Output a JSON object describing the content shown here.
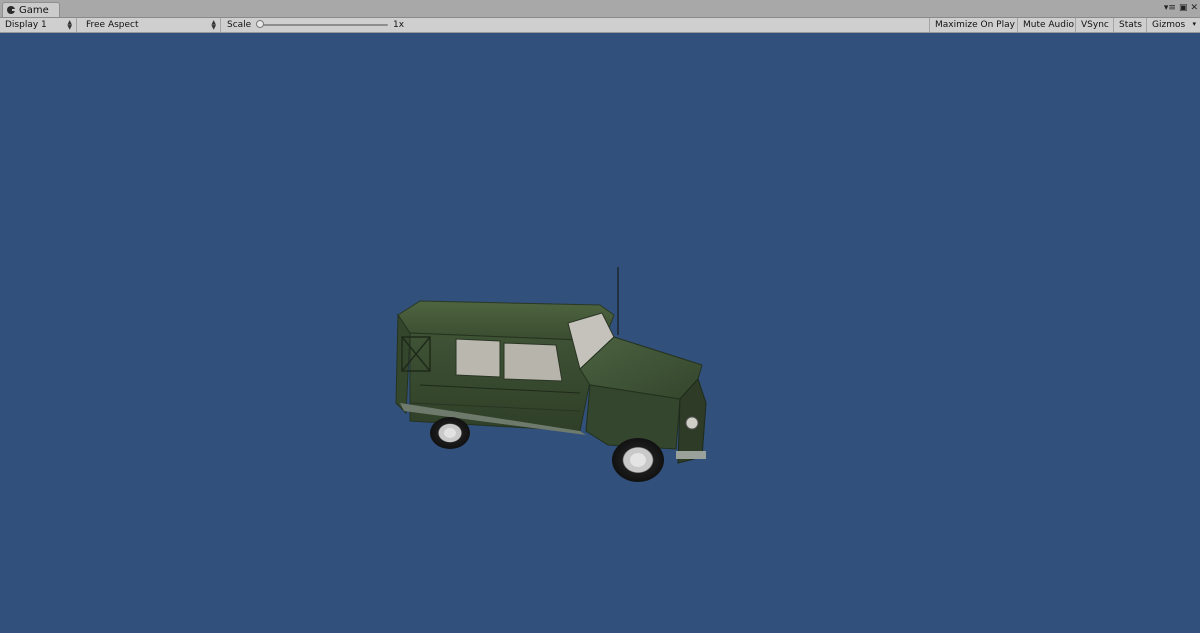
{
  "tab": {
    "title": "Game",
    "icon": "pacman-icon"
  },
  "window_controls": {
    "menu": "▾≡",
    "maximize": "▣",
    "close": "✕"
  },
  "toolbar": {
    "display": "Display 1",
    "aspect": "Free Aspect",
    "scale_label": "Scale",
    "scale_value": "1x",
    "maximize_on_play": "Maximize On Play",
    "mute_audio": "Mute Audio",
    "vsync": "VSync",
    "stats": "Stats",
    "gizmos": "Gizmos",
    "scale_slider_level": 0.0
  },
  "colors": {
    "viewport_background": "#31507b",
    "vehicle_body": "#3f5134"
  },
  "scene": {
    "object": "green-land-rover-vehicle"
  }
}
